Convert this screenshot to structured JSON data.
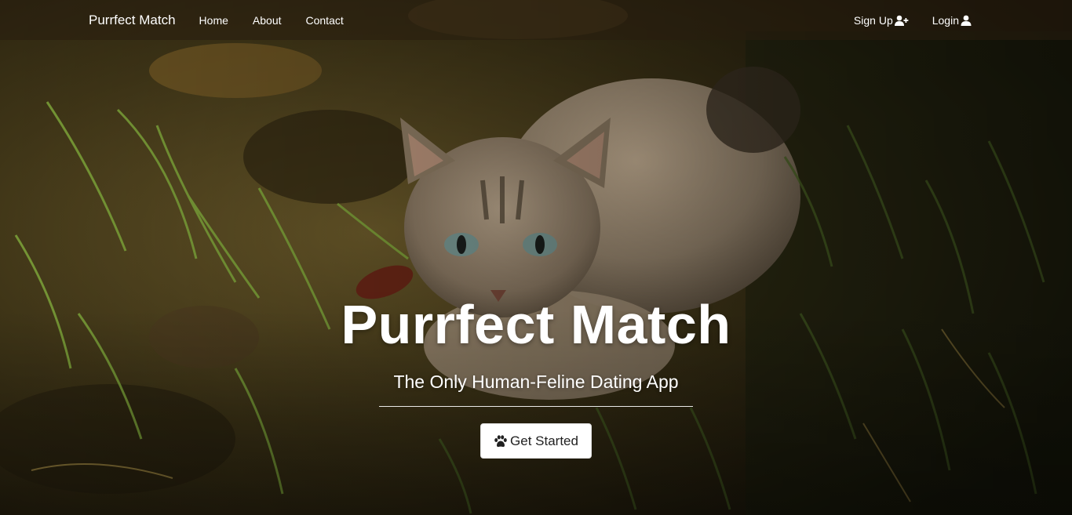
{
  "navbar": {
    "brand": "Purrfect Match",
    "links": [
      "Home",
      "About",
      "Contact"
    ],
    "signup_label": "Sign Up",
    "signup_icon": "user-plus-icon",
    "login_label": "Login",
    "login_icon": "user-icon"
  },
  "hero": {
    "title": "Purrfect Match",
    "subtitle": "The Only Human-Feline Dating App",
    "cta_label": "Get Started",
    "cta_icon": "paw-icon"
  },
  "colors": {
    "text": "#ffffff",
    "button_bg": "#ffffff",
    "button_text": "#212121",
    "navbar_bg": "rgba(40,30,15,0.55)"
  }
}
